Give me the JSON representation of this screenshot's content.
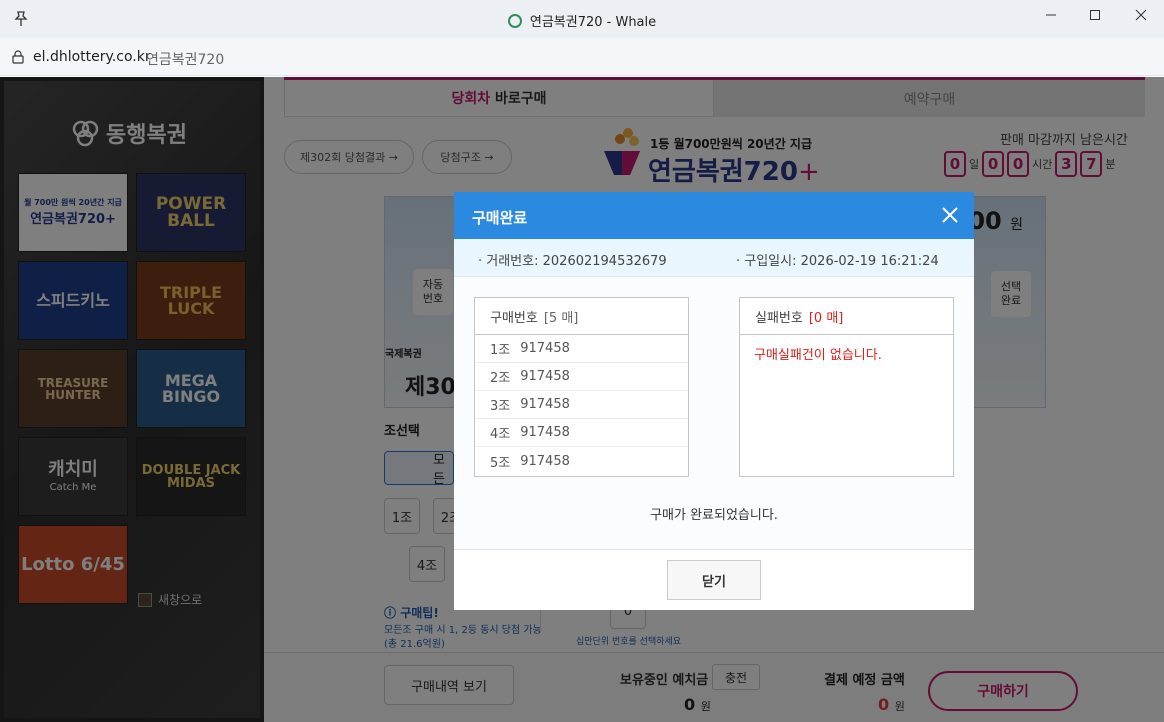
{
  "window": {
    "title": "연금복권720 - Whale",
    "colors": {
      "accent": "#2b8ae0",
      "brand": "#c51b6f",
      "error": "#e0201c"
    }
  },
  "address": {
    "url": "el.dhlottery.co.kr",
    "page_title": "연금복권720"
  },
  "sidebar": {
    "logo": "동행복권",
    "games": [
      {
        "name": "연금복권720+",
        "sub": "월 700만 원씩 20년간 지급"
      },
      {
        "name": "POWER BALL"
      },
      {
        "name": "스피드키노"
      },
      {
        "name": "TRIPLE LUCK"
      },
      {
        "name": "TREASURE HUNTER"
      },
      {
        "name": "MEGA BINGO"
      },
      {
        "name": "캐치미",
        "sub": "Catch Me"
      },
      {
        "name": "DOUBLE JACK MIDAS"
      },
      {
        "name": "Lotto 6/45"
      }
    ],
    "new_window_label": "새창으로"
  },
  "content": {
    "tabs": [
      {
        "label_hl": "당회차",
        "label_rest": "바로구매",
        "active": true
      },
      {
        "label": "예약구매",
        "active": false
      }
    ],
    "result_button": "제302회 당첨결과 →",
    "structure_button": "당첨구조 →",
    "brand": {
      "subtitle": "1등 월700만원씩 20년간 지급",
      "title": "연금복권720",
      "plus": "+"
    },
    "deadline": {
      "label": "판매 마감까지 남은시간",
      "days": "0",
      "day_unit": "일",
      "hours": [
        "0",
        "0"
      ],
      "hour_unit": "시간",
      "mins": [
        "3",
        "7"
      ],
      "min_unit": "분"
    },
    "ticket": {
      "auto_label": "자동\n번호",
      "select_done_label": "선택\n완료",
      "amount": "00",
      "amount_unit": "원",
      "national": "국제복권",
      "round_prefix": "제30"
    },
    "group_select_label": "조선택",
    "all_button": "모든",
    "group_buttons": [
      "1조",
      "2조",
      "4조"
    ],
    "tip_title": "구매팁!",
    "tip_text": "모든조 구매 시 1, 2등 동시 당첨 가능(총 21.6억원)",
    "zero_box": "0",
    "digit_hint": "십만단위 번호를 선택하세요",
    "bottom": {
      "history_button": "구매내역 보기",
      "balance_label": "보유중인 예치금",
      "charge_button": "충전",
      "balance_value": "0",
      "currency": "원",
      "pay_label": "결제 예정 금액",
      "pay_value": "0",
      "buy_button": "구매하기"
    }
  },
  "modal": {
    "title": "구매완료",
    "trade_no_label": "· 거래번호:",
    "trade_no": "202602194532679",
    "buy_date_label": "· 구입일시:",
    "buy_date": "2026-02-19 16:21:24",
    "purchased": {
      "header": "구매번호",
      "count": "[5 매]",
      "rows": [
        {
          "group": "1조",
          "number": "917458"
        },
        {
          "group": "2조",
          "number": "917458"
        },
        {
          "group": "3조",
          "number": "917458"
        },
        {
          "group": "4조",
          "number": "917458"
        },
        {
          "group": "5조",
          "number": "917458"
        }
      ]
    },
    "failed": {
      "header": "실패번호",
      "count": "[0 매]",
      "message": "구매실패건이 없습니다."
    },
    "done_message": "구매가 완료되었습니다.",
    "close_button": "닫기"
  }
}
